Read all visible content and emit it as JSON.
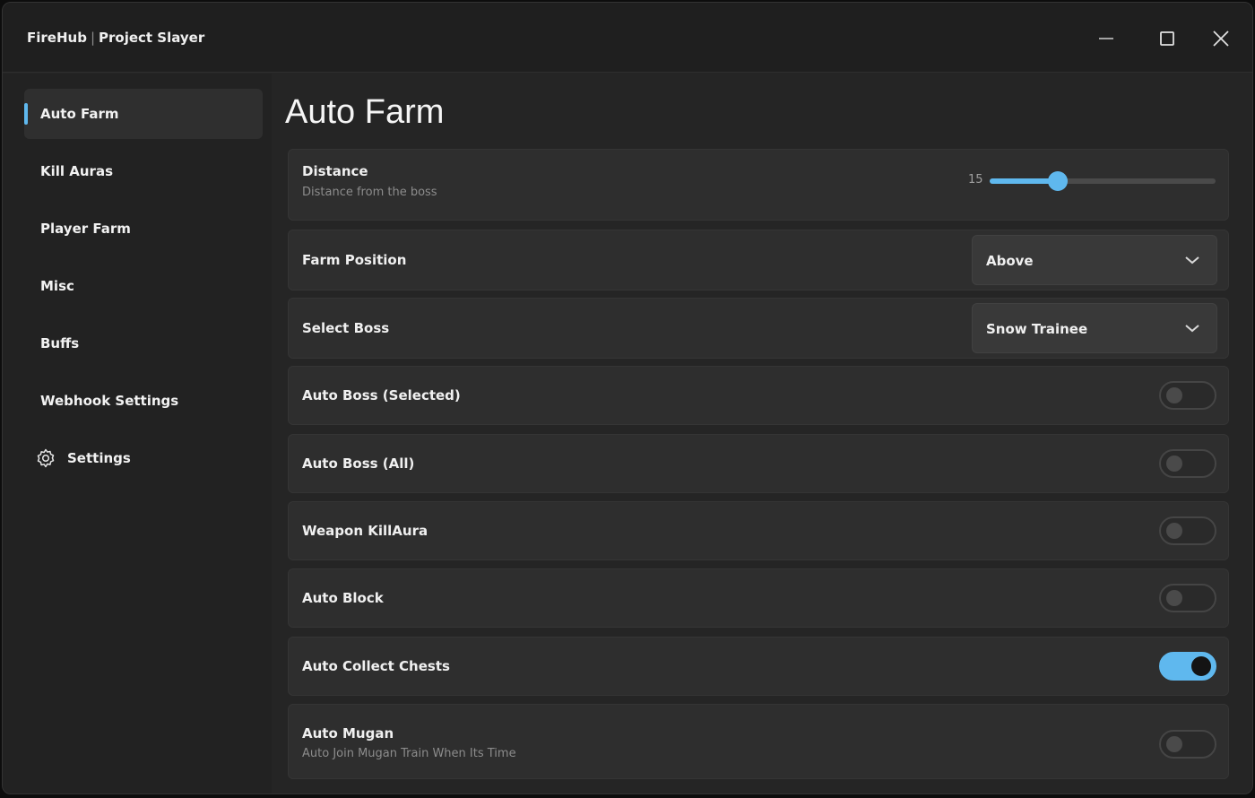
{
  "window": {
    "app_name": "FireHub",
    "separator": "|",
    "game_name": "Project Slayer"
  },
  "sidebar": {
    "items": [
      {
        "label": "Auto Farm",
        "active": true
      },
      {
        "label": "Kill Auras",
        "active": false
      },
      {
        "label": "Player Farm",
        "active": false
      },
      {
        "label": "Misc",
        "active": false
      },
      {
        "label": "Buffs",
        "active": false
      },
      {
        "label": "Webhook Settings",
        "active": false
      },
      {
        "label": "Settings",
        "active": false,
        "icon": "gear-icon"
      }
    ]
  },
  "main": {
    "title": "Auto Farm",
    "distance": {
      "label": "Distance",
      "description": "Distance from the boss",
      "value": "15",
      "level": 0.3
    },
    "farm_position": {
      "label": "Farm Position",
      "value": "Above"
    },
    "select_boss": {
      "label": "Select Boss",
      "value": "Snow Trainee"
    },
    "toggles": [
      {
        "label": "Auto Boss (Selected)",
        "on": false
      },
      {
        "label": "Auto Boss (All)",
        "on": false
      },
      {
        "label": "Weapon KillAura",
        "on": false
      },
      {
        "label": "Auto Block",
        "on": false
      },
      {
        "label": "Auto Collect Chests",
        "on": true
      },
      {
        "label": "Auto Mugan",
        "description": "Auto Join Mugan Train When Its Time",
        "on": false
      }
    ]
  },
  "colors": {
    "accent": "#5fb8ee",
    "window_bg": "#252525",
    "row_bg": "#2e2e2e"
  }
}
